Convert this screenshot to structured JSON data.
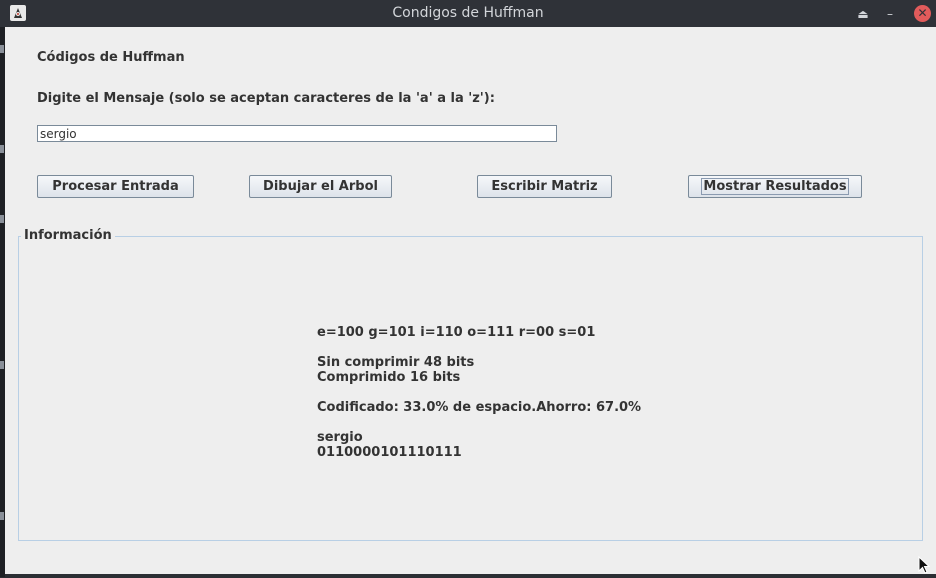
{
  "window": {
    "title": "Condigos de Huffman",
    "controls": {
      "shade": "⏏",
      "minimize": "–",
      "close": "✕"
    }
  },
  "header": {
    "title": "Códigos de Huffman",
    "prompt": "Digite el Mensaje (solo se aceptan caracteres de la 'a' a la 'z'):"
  },
  "input": {
    "value": "sergio",
    "placeholder": ""
  },
  "buttons": {
    "procesar": "Procesar Entrada",
    "dibujar": "Dibujar el Arbol",
    "escribir": "Escribir Matriz",
    "mostrar": "Mostrar Resultados"
  },
  "info": {
    "title": "Información",
    "codes": "e=100 g=101 i=110 o=111 r=00 s=01",
    "uncompressed": "Sin comprimir 48 bits",
    "compressed": "Comprimido 16 bits",
    "ratio": "Codificado: 33.0% de espacio.Ahorro: 67.0%",
    "message": "sergio",
    "encoded": "0110000101110111"
  },
  "colors": {
    "titlebar": "#2f3238",
    "window_bg": "#eeeeee",
    "close_button": "#e25b5b",
    "group_border": "#b8cfe5"
  },
  "icons": {
    "app": "java-duke-icon",
    "shade": "eject-icon",
    "minimize": "minimize-icon",
    "close": "close-icon",
    "cursor": "mouse-pointer-icon"
  }
}
